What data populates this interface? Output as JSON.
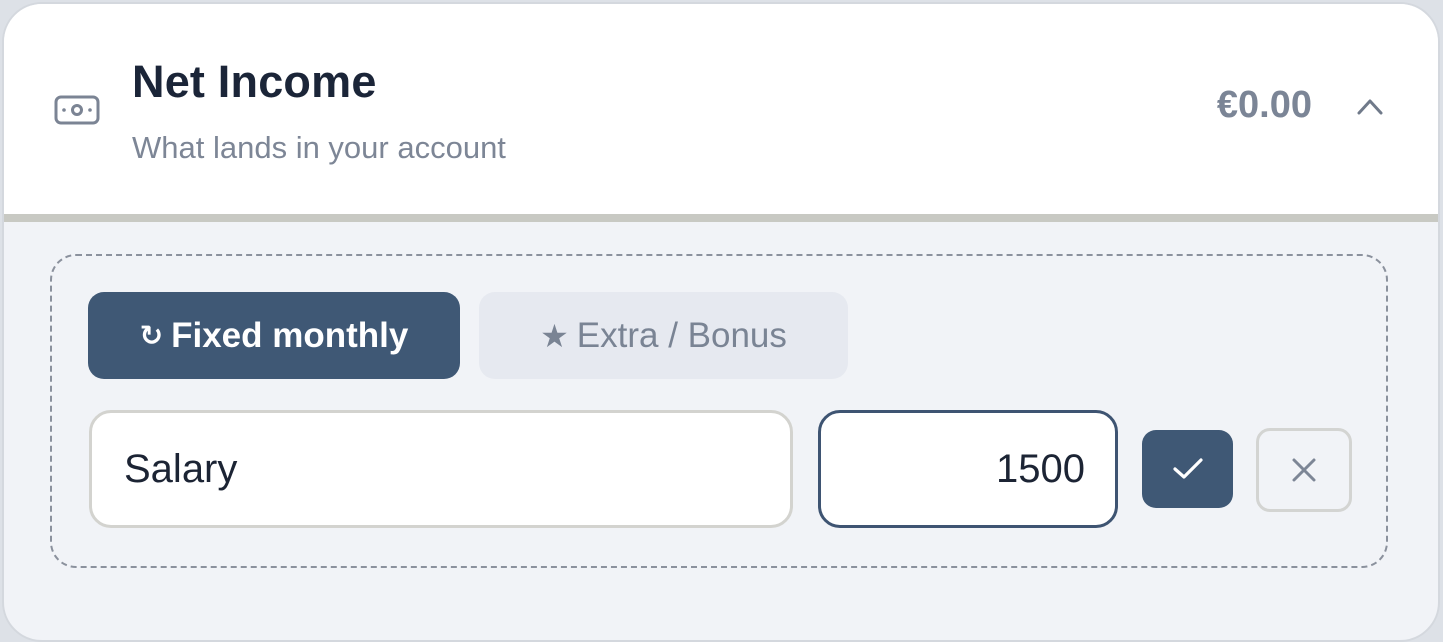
{
  "section": {
    "icon": "banknote-icon",
    "title": "Net Income",
    "subtitle": "What lands in your account",
    "total": "€0.00",
    "toggle_icon": "chevron-up-icon"
  },
  "tabs": [
    {
      "icon": "repeat-icon",
      "glyph": "↻",
      "label": "Fixed monthly",
      "active": true
    },
    {
      "icon": "star-icon",
      "glyph": "★",
      "label": "Extra / Bonus",
      "active": false
    }
  ],
  "form": {
    "name_value": "Salary",
    "amount_value": "1500",
    "confirm_icon": "check-icon",
    "cancel_icon": "close-icon"
  },
  "colors": {
    "accent": "#3f5875",
    "title": "#1b2538",
    "muted": "#7d8696",
    "background": "#f1f3f7"
  }
}
